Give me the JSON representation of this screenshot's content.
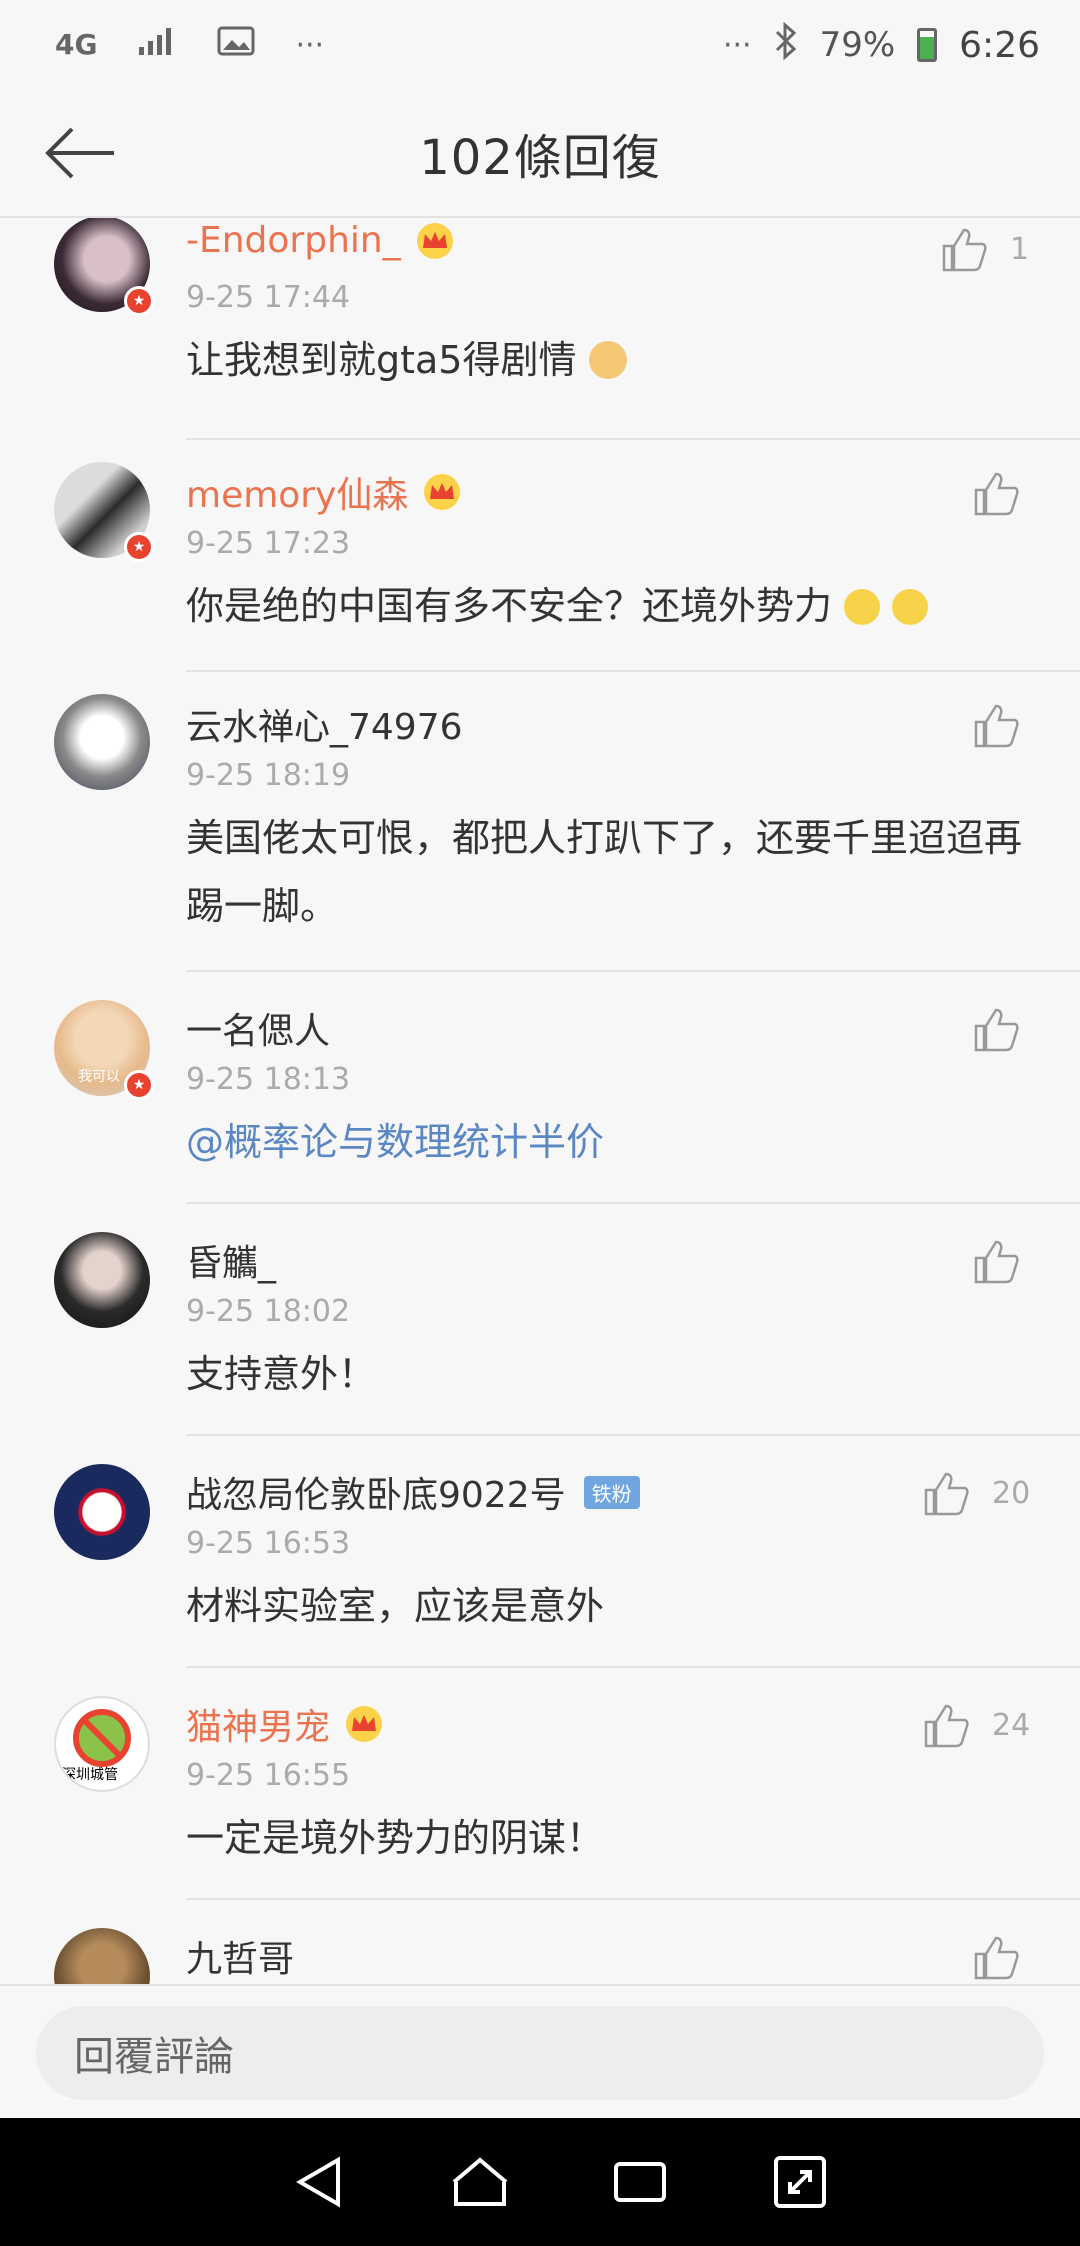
{
  "status_bar": {
    "network": "4G",
    "battery": "79%",
    "time": "6:26"
  },
  "header": {
    "title": "102條回復"
  },
  "comments": [
    {
      "user": "-Endorphin_",
      "time": "9-25 17:44",
      "text": "让我想到就gta5得剧情",
      "likes": "1"
    },
    {
      "user": "memory仙森",
      "time": "9-25 17:23",
      "text": "你是绝的中国有多不安全？还境外势力",
      "likes": ""
    },
    {
      "user": "云水禅心_74976",
      "time": "9-25 18:19",
      "text": "美国佬太可恨，都把人打趴下了，还要千里迢迢再踢一脚。",
      "likes": ""
    },
    {
      "user": "一名偲人",
      "time": "9-25 18:13",
      "text": "@概率论与数理统计半价",
      "likes": "",
      "avatar_caption": "我可以"
    },
    {
      "user": "昏觿_",
      "time": "9-25 18:02",
      "text": "支持意外！",
      "likes": ""
    },
    {
      "user": "战忽局伦敦卧底9022号",
      "badge": "铁粉",
      "time": "9-25 16:53",
      "text": "材料实验室，应该是意外",
      "likes": "20"
    },
    {
      "user": "猫神男宠",
      "time": "9-25 16:55",
      "text": "一定是境外势力的阴谋！",
      "likes": "24",
      "avatar_caption": "深圳城管"
    },
    {
      "user": "九哲哥",
      "time": "",
      "text": "",
      "likes": ""
    }
  ],
  "reply_bar": {
    "placeholder": "回覆評論"
  },
  "colors": {
    "vip_name": "#eb7350",
    "link": "#5b87c5",
    "meta": "#aaaaaa"
  }
}
